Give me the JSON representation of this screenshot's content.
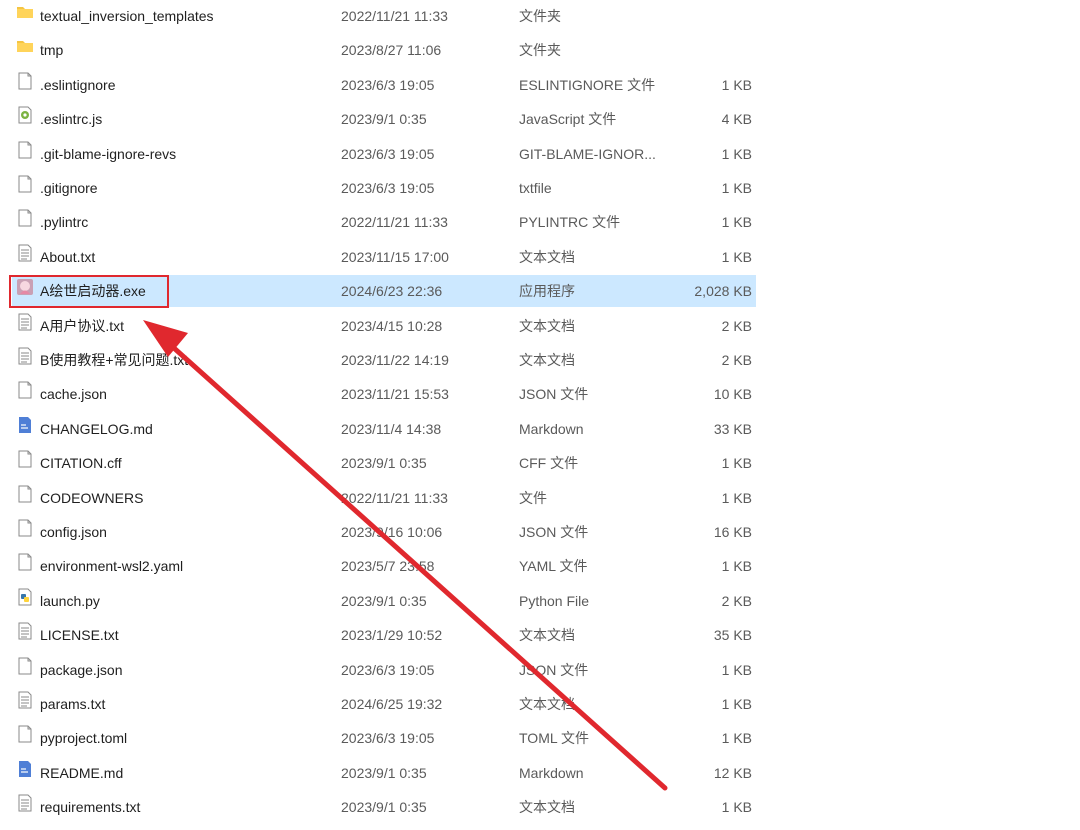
{
  "highlighted_file": "A绘世启动器.exe",
  "colors": {
    "selection": "#cce8ff",
    "annotation": "#e0282e",
    "folder": "#f5c542"
  },
  "files": [
    {
      "name": "textual_inversion_templates",
      "date": "2022/11/21 11:33",
      "type": "文件夹",
      "size": "",
      "icon": "folder-icon"
    },
    {
      "name": "tmp",
      "date": "2023/8/27 11:06",
      "type": "文件夹",
      "size": "",
      "icon": "folder-icon"
    },
    {
      "name": ".eslintignore",
      "date": "2023/6/3 19:05",
      "type": "ESLINTIGNORE 文件",
      "size": "1 KB",
      "icon": "file-icon"
    },
    {
      "name": ".eslintrc.js",
      "date": "2023/9/1 0:35",
      "type": "JavaScript 文件",
      "size": "4 KB",
      "icon": "script-file-icon"
    },
    {
      "name": ".git-blame-ignore-revs",
      "date": "2023/6/3 19:05",
      "type": "GIT-BLAME-IGNOR...",
      "size": "1 KB",
      "icon": "file-icon"
    },
    {
      "name": ".gitignore",
      "date": "2023/6/3 19:05",
      "type": "txtfile",
      "size": "1 KB",
      "icon": "file-icon"
    },
    {
      "name": ".pylintrc",
      "date": "2022/11/21 11:33",
      "type": "PYLINTRC 文件",
      "size": "1 KB",
      "icon": "file-icon"
    },
    {
      "name": "About.txt",
      "date": "2023/11/15 17:00",
      "type": "文本文档",
      "size": "1 KB",
      "icon": "text-file-icon"
    },
    {
      "name": "A绘世启动器.exe",
      "date": "2024/6/23 22:36",
      "type": "应用程序",
      "size": "2,028 KB",
      "icon": "app-icon",
      "selected": true
    },
    {
      "name": "A用户协议.txt",
      "date": "2023/4/15 10:28",
      "type": "文本文档",
      "size": "2 KB",
      "icon": "text-file-icon"
    },
    {
      "name": "B使用教程+常见问题.txt",
      "date": "2023/11/22 14:19",
      "type": "文本文档",
      "size": "2 KB",
      "icon": "text-file-icon"
    },
    {
      "name": "cache.json",
      "date": "2023/11/21 15:53",
      "type": "JSON 文件",
      "size": "10 KB",
      "icon": "file-icon"
    },
    {
      "name": "CHANGELOG.md",
      "date": "2023/11/4 14:38",
      "type": "Markdown",
      "size": "33 KB",
      "icon": "markdown-file-icon"
    },
    {
      "name": "CITATION.cff",
      "date": "2023/9/1 0:35",
      "type": "CFF 文件",
      "size": "1 KB",
      "icon": "file-icon"
    },
    {
      "name": "CODEOWNERS",
      "date": "2022/11/21 11:33",
      "type": "文件",
      "size": "1 KB",
      "icon": "file-icon"
    },
    {
      "name": "config.json",
      "date": "2023/9/16 10:06",
      "type": "JSON 文件",
      "size": "16 KB",
      "icon": "file-icon"
    },
    {
      "name": "environment-wsl2.yaml",
      "date": "2023/5/7 23:58",
      "type": "YAML 文件",
      "size": "1 KB",
      "icon": "file-icon"
    },
    {
      "name": "launch.py",
      "date": "2023/9/1 0:35",
      "type": "Python File",
      "size": "2 KB",
      "icon": "python-file-icon"
    },
    {
      "name": "LICENSE.txt",
      "date": "2023/1/29 10:52",
      "type": "文本文档",
      "size": "35 KB",
      "icon": "text-file-icon"
    },
    {
      "name": "package.json",
      "date": "2023/6/3 19:05",
      "type": "JSON 文件",
      "size": "1 KB",
      "icon": "file-icon"
    },
    {
      "name": "params.txt",
      "date": "2024/6/25 19:32",
      "type": "文本文档",
      "size": "1 KB",
      "icon": "text-file-icon"
    },
    {
      "name": "pyproject.toml",
      "date": "2023/6/3 19:05",
      "type": "TOML 文件",
      "size": "1 KB",
      "icon": "file-icon"
    },
    {
      "name": "README.md",
      "date": "2023/9/1 0:35",
      "type": "Markdown",
      "size": "12 KB",
      "icon": "markdown-file-icon"
    },
    {
      "name": "requirements.txt",
      "date": "2023/9/1 0:35",
      "type": "文本文档",
      "size": "1 KB",
      "icon": "text-file-icon"
    }
  ]
}
